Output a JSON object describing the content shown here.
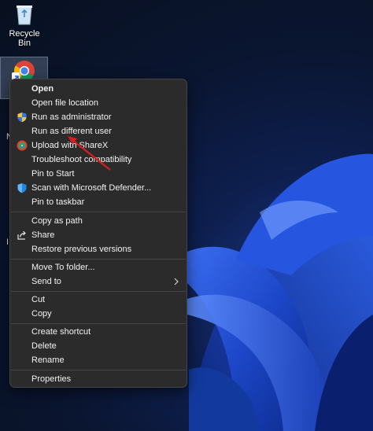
{
  "desktop": {
    "recycle_bin_label": "Recycle Bin",
    "side_letters": [
      "N",
      "I"
    ]
  },
  "context_menu": {
    "items": [
      {
        "label": "Open",
        "bold": true,
        "icon": ""
      },
      {
        "label": "Open file location",
        "icon": ""
      },
      {
        "label": "Run as administrator",
        "icon": "uac-shield-icon"
      },
      {
        "label": "Run as different user",
        "icon": ""
      },
      {
        "label": "Upload with ShareX",
        "icon": "sharex-icon"
      },
      {
        "label": "Troubleshoot compatibility",
        "icon": ""
      },
      {
        "label": "Pin to Start",
        "icon": ""
      },
      {
        "label": "Scan with Microsoft Defender...",
        "icon": "defender-shield-icon"
      },
      {
        "label": "Pin to taskbar",
        "icon": ""
      },
      {
        "label": "Copy as path",
        "icon": ""
      },
      {
        "label": "Share",
        "icon": "share-icon"
      },
      {
        "label": "Restore previous versions",
        "icon": ""
      },
      {
        "label": "Move To folder...",
        "icon": ""
      },
      {
        "label": "Send to",
        "icon": "",
        "submenu": true
      },
      {
        "label": "Cut",
        "icon": ""
      },
      {
        "label": "Copy",
        "icon": ""
      },
      {
        "label": "Create shortcut",
        "icon": ""
      },
      {
        "label": "Delete",
        "icon": ""
      },
      {
        "label": "Rename",
        "icon": ""
      },
      {
        "label": "Properties",
        "icon": ""
      }
    ]
  },
  "colors": {
    "menu_bg": "#2b2b2b",
    "menu_text": "#f2f2f2",
    "annotation_arrow": "#d81e1e",
    "wallpaper_blue": "#1e4fd8"
  }
}
